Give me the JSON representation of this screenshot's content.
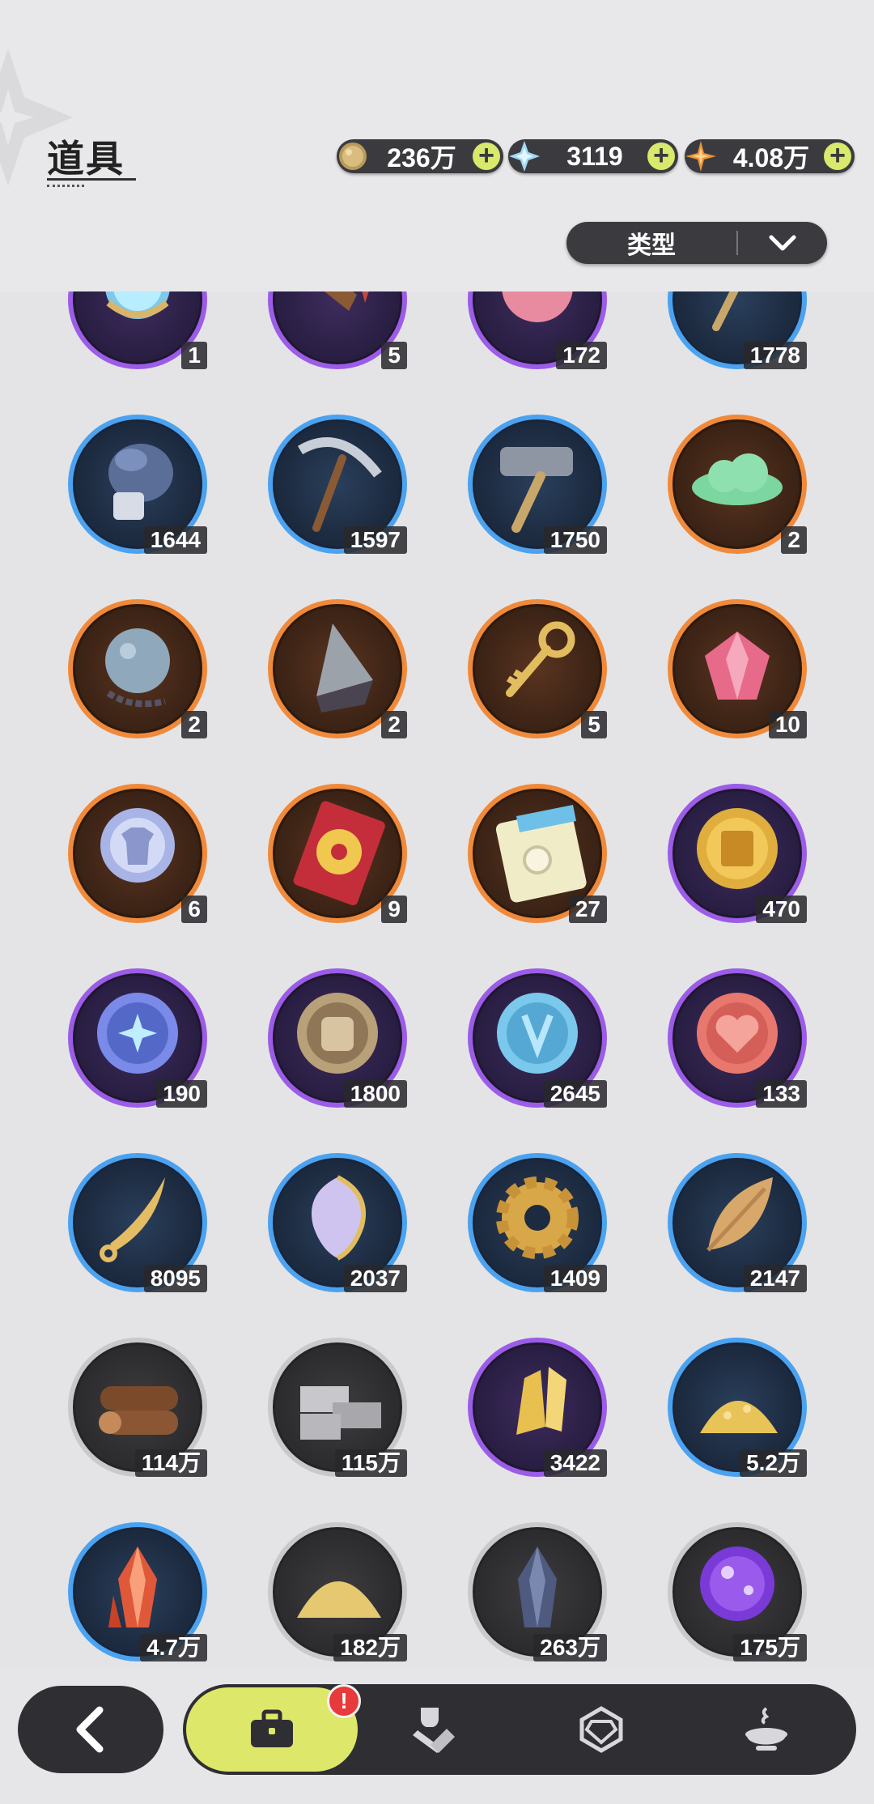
{
  "header": {
    "title": "道具"
  },
  "currencies": [
    {
      "icon": "gold-coin-icon",
      "value": "236万"
    },
    {
      "icon": "crystal-icon",
      "value": "3119"
    },
    {
      "icon": "star-gem-icon",
      "value": "4.08万"
    }
  ],
  "filter": {
    "label": "类型"
  },
  "items": [
    {
      "icon": "mirror-icon",
      "rarity": "purple",
      "count": "1"
    },
    {
      "icon": "wood-tool-icon",
      "rarity": "purple",
      "count": "5"
    },
    {
      "icon": "pink-orb-icon",
      "rarity": "purple",
      "count": "172"
    },
    {
      "icon": "wand-icon",
      "rarity": "blue",
      "count": "1778"
    },
    {
      "icon": "boxing-glove-icon",
      "rarity": "blue",
      "count": "1644"
    },
    {
      "icon": "pickaxe-icon",
      "rarity": "blue",
      "count": "1597"
    },
    {
      "icon": "hammer-icon",
      "rarity": "blue",
      "count": "1750"
    },
    {
      "icon": "green-cloud-icon",
      "rarity": "orange",
      "count": "2"
    },
    {
      "icon": "spiked-ball-icon",
      "rarity": "orange",
      "count": "2"
    },
    {
      "icon": "drill-icon",
      "rarity": "orange",
      "count": "2"
    },
    {
      "icon": "golden-key-icon",
      "rarity": "orange",
      "count": "5"
    },
    {
      "icon": "crystal-apple-icon",
      "rarity": "orange",
      "count": "10"
    },
    {
      "icon": "outfit-token-icon",
      "rarity": "orange",
      "count": "6"
    },
    {
      "icon": "wheel-ticket-icon",
      "rarity": "orange",
      "count": "9"
    },
    {
      "icon": "rainbow-ticket-icon",
      "rarity": "orange",
      "count": "27"
    },
    {
      "icon": "gold-coin-item-icon",
      "rarity": "purple",
      "count": "470"
    },
    {
      "icon": "star-moon-coin-icon",
      "rarity": "purple",
      "count": "190"
    },
    {
      "icon": "fist-coin-icon",
      "rarity": "purple",
      "count": "1800"
    },
    {
      "icon": "blue-emblem-coin-icon",
      "rarity": "purple",
      "count": "2645"
    },
    {
      "icon": "heart-coin-icon",
      "rarity": "purple",
      "count": "133"
    },
    {
      "icon": "golden-blade-icon",
      "rarity": "blue",
      "count": "8095"
    },
    {
      "icon": "scale-shard-icon",
      "rarity": "blue",
      "count": "2037"
    },
    {
      "icon": "gear-icon",
      "rarity": "blue",
      "count": "1409"
    },
    {
      "icon": "golden-leaf-icon",
      "rarity": "blue",
      "count": "2147"
    },
    {
      "icon": "logs-icon",
      "rarity": "gray",
      "count": "114万"
    },
    {
      "icon": "stone-bricks-icon",
      "rarity": "gray",
      "count": "115万"
    },
    {
      "icon": "gold-crystal-icon",
      "rarity": "purple",
      "count": "3422"
    },
    {
      "icon": "gold-dust-icon",
      "rarity": "blue",
      "count": "5.2万"
    },
    {
      "icon": "red-crystal-icon",
      "rarity": "blue",
      "count": "4.7万"
    },
    {
      "icon": "sand-pile-icon",
      "rarity": "gray",
      "count": "182万"
    },
    {
      "icon": "dark-crystal-icon",
      "rarity": "gray",
      "count": "263万"
    },
    {
      "icon": "purple-orb-icon",
      "rarity": "gray",
      "count": "175万"
    }
  ],
  "nav": {
    "tabs": [
      {
        "icon": "toolbox-icon",
        "active": true,
        "badge": "!"
      },
      {
        "icon": "armor-icon",
        "active": false
      },
      {
        "icon": "gem-icon",
        "active": false
      },
      {
        "icon": "cauldron-icon",
        "active": false
      }
    ]
  }
}
